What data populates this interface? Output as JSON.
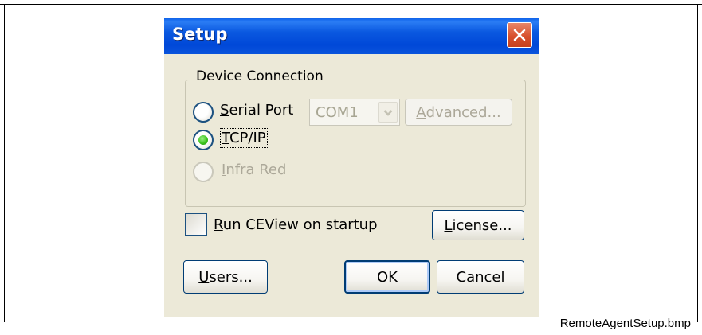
{
  "dialog": {
    "title": "Setup",
    "group_label": "Device Connection",
    "serial_port": {
      "label_underlined": "S",
      "label_rest": "erial Port",
      "selected": false
    },
    "com_combo": {
      "value": "COM1"
    },
    "advanced_button": {
      "label_underlined": "A",
      "label_rest": "dvanced..."
    },
    "tcpip": {
      "label_underlined": "T",
      "label_rest": "CP/IP",
      "selected": true
    },
    "infrared": {
      "label_underlined": "I",
      "label_rest": "nfra Red",
      "selected": false
    },
    "run_on_startup": {
      "label_underlined": "R",
      "label_rest": "un CEView on startup",
      "checked": false
    },
    "license_button": {
      "label_underlined": "L",
      "label_rest": "icense..."
    },
    "users_button": {
      "label_underlined": "U",
      "label_rest": "sers..."
    },
    "ok_button": {
      "label": "OK"
    },
    "cancel_button": {
      "label": "Cancel"
    }
  },
  "caption": "RemoteAgentSetup.bmp",
  "colors": {
    "titlebar": "#0a58e0",
    "dialog_bg": "#ece9d8",
    "close_button": "#d8502c",
    "radio_selected": "#3cc41c"
  }
}
